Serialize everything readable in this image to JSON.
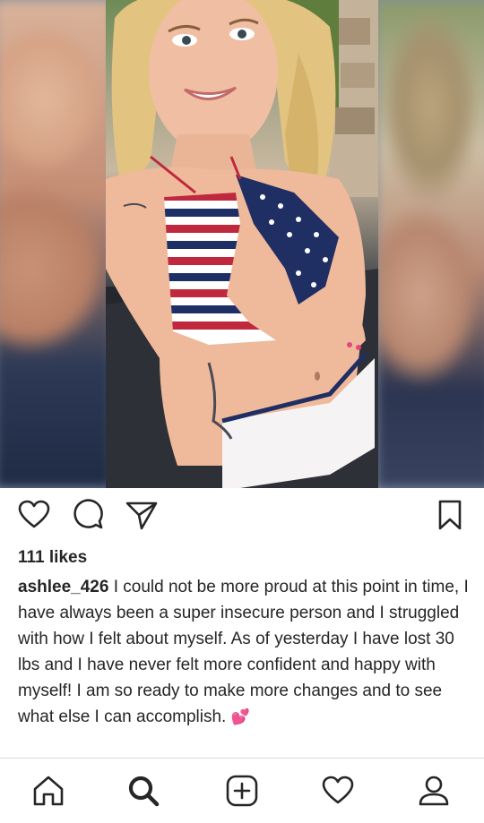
{
  "post": {
    "likes": "111 likes",
    "username": "ashlee_426",
    "caption": "I could not be more proud at this point in time, I have always been a super insecure person and I struggled with how I felt about myself. As of yesterday I have lost 30 lbs and I have never felt more confident and happy with myself! I am so ready to make more changes and to see what else I can accomplish.",
    "emoji": "💕"
  },
  "actions": {
    "icons": [
      "heart-icon",
      "comment-icon",
      "share-icon",
      "bookmark-icon"
    ]
  },
  "bottom_nav": {
    "icons": [
      "home-icon",
      "search-icon",
      "add-icon",
      "activity-heart-icon",
      "profile-icon"
    ]
  },
  "colors": {
    "text": "#262626",
    "divider": "#dbdbdb",
    "emoji_pink": "#ff5fa8"
  }
}
